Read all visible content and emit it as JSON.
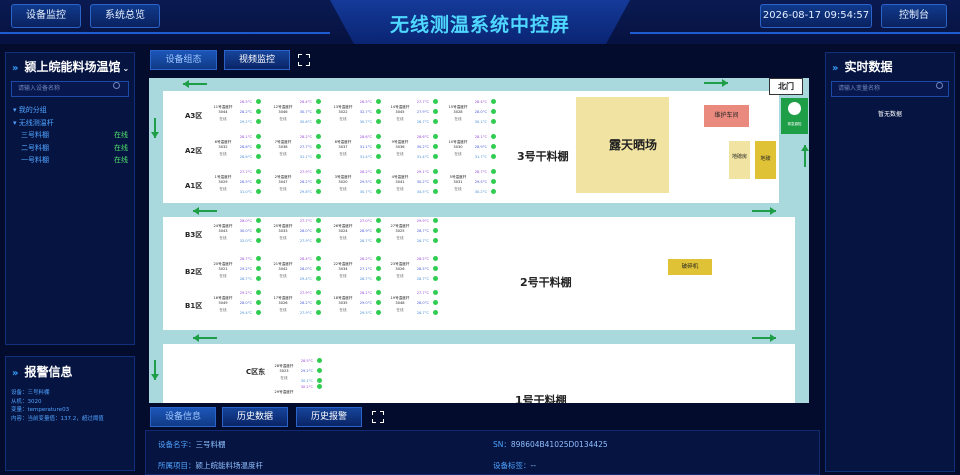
{
  "header": {
    "title": "无线测温系统中控屏",
    "btn_monitor": "设备监控",
    "btn_overview": "系统总览",
    "datetime": "2026-08-17 09:54:57",
    "btn_console": "控制台"
  },
  "left": {
    "title": "颍上皖能料场温馆",
    "search_placeholder": "请输入设备名称",
    "tree": [
      {
        "label": "我的分组",
        "status": ""
      },
      {
        "label": "无线测温杆",
        "status": ""
      },
      {
        "label": "三号料棚",
        "status": "在线"
      },
      {
        "label": "二号料棚",
        "status": "在线"
      },
      {
        "label": "一号料棚",
        "status": "在线"
      }
    ]
  },
  "alarm": {
    "title": "报警信息",
    "lines": [
      "设备：三号料棚",
      "从机：3020",
      "变量：temperature03",
      "内容：当前变量值：137.2，超过阈值"
    ]
  },
  "tabs": {
    "device_config": "设备组态",
    "video": "视频监控"
  },
  "bottom_tabs": {
    "info": "设备信息",
    "history": "历史数据",
    "alarm_history": "历史报警"
  },
  "bottom_info": {
    "device_name_label": "设备名字：",
    "device_name": "三号料棚",
    "sn_label": "SN：",
    "sn": "898604B41025D0134425",
    "project_label": "所属项目：",
    "project": "颍上皖能料场温度杆",
    "tag_label": "设备标签：",
    "tag": "--"
  },
  "right": {
    "title": "实时数据",
    "search_placeholder": "请输入变量名称",
    "empty": "暂无数据"
  },
  "map": {
    "north_gate": "北门",
    "shed3": "3号干料棚",
    "shed2": "2号干料棚",
    "shed1": "1号干料棚",
    "yard": "露天晒场",
    "maintenance": "维护车间",
    "small1": "地磅房",
    "small2": "地磅",
    "crusher": "破碎机",
    "emergency": "紧急避险",
    "zones": [
      "A3区",
      "A2区",
      "A1区",
      "B3区",
      "B2区",
      "B1区",
      "C区东"
    ],
    "sensors": [
      {
        "name": "11号温度杆",
        "id": "3044",
        "t": [
          "28.5°C",
          "28.2°C",
          "29.1°C"
        ]
      },
      {
        "name": "12号温度杆",
        "id": "3046",
        "t": [
          "28.4°C",
          "30.7°C",
          "30.6°C"
        ]
      },
      {
        "name": "13号温度杆",
        "id": "3022",
        "t": [
          "28.5°C",
          "32.7°C",
          "30.7°C"
        ]
      },
      {
        "name": "14号温度杆",
        "id": "3045",
        "t": [
          "27.7°C",
          "27.9°C",
          "28.7°C"
        ]
      },
      {
        "name": "15号温度杆",
        "id": "3028",
        "t": [
          "28.4°C",
          "28.0°C",
          "30.1°C"
        ]
      },
      {
        "name": "6号温度杆",
        "id": "3032",
        "t": [
          "28.1°C",
          "28.8°C",
          "28.6°C"
        ]
      },
      {
        "name": "7号温度杆",
        "id": "3038",
        "t": [
          "28.2°C",
          "27.7°C",
          "31.1°C"
        ]
      },
      {
        "name": "8号温度杆",
        "id": "3037",
        "t": [
          "28.6°C",
          "31.1°C",
          "31.4°C"
        ]
      },
      {
        "name": "9号温度杆",
        "id": "3036",
        "t": [
          "28.6°C",
          "30.2°C",
          "31.4°C"
        ]
      },
      {
        "name": "10号温度杆",
        "id": "3030",
        "t": [
          "28.1°C",
          "28.9°C",
          "31.7°C"
        ]
      },
      {
        "name": "1号温度杆",
        "id": "3029",
        "t": [
          "27.7°C",
          "28.5°C",
          "31.0°C"
        ]
      },
      {
        "name": "2号温度杆",
        "id": "3047",
        "t": [
          "27.9°C",
          "28.2°C",
          "29.8°C"
        ]
      },
      {
        "name": "3号温度杆",
        "id": "3020",
        "t": [
          "28.2°C",
          "29.5°C",
          "30.7°C"
        ]
      },
      {
        "name": "4号温度杆",
        "id": "3041",
        "t": [
          "29.1°C",
          "30.2°C",
          "34.5°C"
        ]
      },
      {
        "name": "5号温度杆",
        "id": "3031",
        "t": [
          "28.7°C",
          "29.5°C",
          "30.2°C"
        ]
      },
      {
        "name": "24号温度杆",
        "id": "3043",
        "t": [
          "28.0°C",
          "30.0°C",
          "32.0°C"
        ]
      },
      {
        "name": "25号温度杆",
        "id": "3033",
        "t": [
          "27.7°C",
          "28.0°C",
          "27.9°C"
        ]
      },
      {
        "name": "26号温度杆",
        "id": "3024",
        "t": [
          "27.0°C",
          "28.9°C",
          "28.7°C"
        ]
      },
      {
        "name": "27号温度杆",
        "id": "3025",
        "t": [
          "29.9°C",
          "28.7°C",
          "28.7°C"
        ]
      },
      {
        "name": "20号温度杆",
        "id": "3021",
        "t": [
          "28.7°C",
          "29.2°C",
          "28.7°C"
        ]
      },
      {
        "name": "21号温度杆",
        "id": "3042",
        "t": [
          "28.4°C",
          "28.0°C",
          "29.4°C"
        ]
      },
      {
        "name": "22号温度杆",
        "id": "3034",
        "t": [
          "28.2°C",
          "27.1°C",
          "28.7°C"
        ]
      },
      {
        "name": "23号温度杆",
        "id": "3026",
        "t": [
          "28.2°C",
          "28.5°C",
          "28.7°C"
        ]
      },
      {
        "name": "16号温度杆",
        "id": "3049",
        "t": [
          "29.2°C",
          "28.0°C",
          "29.4°C"
        ]
      },
      {
        "name": "17号温度杆",
        "id": "3026",
        "t": [
          "27.9°C",
          "28.2°C",
          "27.9°C"
        ]
      },
      {
        "name": "18号温度杆",
        "id": "3035",
        "t": [
          "28.1°C",
          "29.0°C",
          "29.5°C"
        ]
      },
      {
        "name": "19号温度杆",
        "id": "3048",
        "t": [
          "27.7°C",
          "28.0°C",
          "28.7°C"
        ]
      },
      {
        "name": "28号温度杆",
        "id": "3023",
        "t": [
          "28.5°C",
          "29.2°C",
          "30.1°C"
        ]
      },
      {
        "name": "29号温度杆",
        "id": "",
        "t": [
          "30.2°C",
          "",
          ""
        ]
      }
    ],
    "online": "在线"
  }
}
